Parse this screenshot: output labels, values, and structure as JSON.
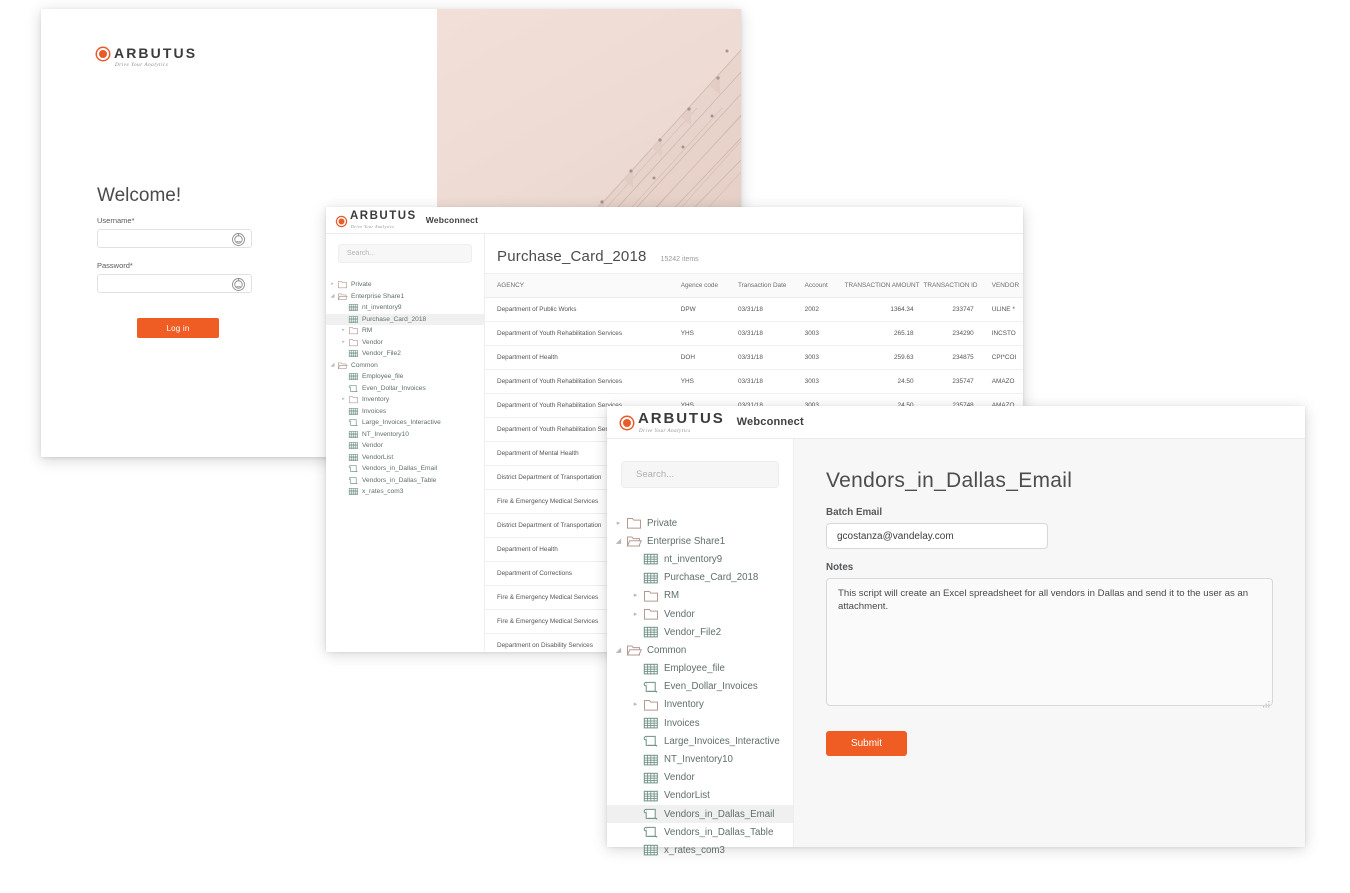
{
  "brand": {
    "name": "ARBUTUS",
    "tagline": "Drive Your Analytics",
    "app": "Webconnect",
    "accent": "#ef5c24"
  },
  "login": {
    "welcome": "Welcome!",
    "username_label": "Username*",
    "username_value": "",
    "password_label": "Password*",
    "password_value": "",
    "login_button": "Log in",
    "field_icon": "circle-key-icon"
  },
  "list_window": {
    "search_placeholder": "Search...",
    "title": "Purchase_Card_2018",
    "item_count": "15242 items",
    "columns": [
      "AGENCY",
      "Agence code",
      "Transaction Date",
      "Account",
      "TRANSACTION AMOUNT",
      "TRANSACTION ID",
      "VENDOR"
    ],
    "rows": [
      [
        "Department of Public Works",
        "DPW",
        "03/31/18",
        "2002",
        "1364.34",
        "233747",
        "ULINE *"
      ],
      [
        "Department of Youth Rehabilitation Services",
        "YHS",
        "03/31/18",
        "3003",
        "265.18",
        "234290",
        "INCSTO"
      ],
      [
        "Department of Health",
        "DOH",
        "03/31/18",
        "3003",
        "259.63",
        "234875",
        "CPI*COI"
      ],
      [
        "Department of Youth Rehabilitation Services",
        "YHS",
        "03/31/18",
        "3003",
        "24.50",
        "235747",
        "AMAZO"
      ],
      [
        "Department of Youth Rehabilitation Services",
        "YHS",
        "03/31/18",
        "3003",
        "24.50",
        "235748",
        "AMAZO"
      ],
      [
        "Department of Youth Rehabilitation Services",
        "",
        "",
        "",
        "",
        "",
        ""
      ],
      [
        "Department of Mental Health",
        "",
        "",
        "",
        "",
        "",
        ""
      ],
      [
        "District Department of Transportation",
        "",
        "",
        "",
        "",
        "",
        ""
      ],
      [
        "Fire & Emergency Medical Services",
        "",
        "",
        "",
        "",
        "",
        ""
      ],
      [
        "District Department of Transportation",
        "",
        "",
        "",
        "",
        "",
        ""
      ],
      [
        "Department of Health",
        "",
        "",
        "",
        "",
        "",
        ""
      ],
      [
        "Department of Corrections",
        "",
        "",
        "",
        "",
        "",
        ""
      ],
      [
        "Fire & Emergency Medical Services",
        "",
        "",
        "",
        "",
        "",
        ""
      ],
      [
        "Fire & Emergency Medical Services",
        "",
        "",
        "",
        "",
        "",
        ""
      ],
      [
        "Department on Disability Services",
        "",
        "",
        "",
        "",
        "",
        ""
      ]
    ],
    "tree": [
      {
        "label": "Private",
        "icon": "folder-closed-icon",
        "level": 1,
        "twist": "collapsed",
        "selected": false
      },
      {
        "label": "Enterprise Share1",
        "icon": "folder-open-icon",
        "level": 1,
        "twist": "expanded",
        "selected": false
      },
      {
        "label": "nt_inventory9",
        "icon": "table-icon",
        "level": 2,
        "twist": "none",
        "selected": false
      },
      {
        "label": "Purchase_Card_2018",
        "icon": "table-icon",
        "level": 2,
        "twist": "none",
        "selected": true
      },
      {
        "label": "RM",
        "icon": "folder-closed-icon",
        "level": 2,
        "twist": "collapsed",
        "selected": false
      },
      {
        "label": "Vendor",
        "icon": "folder-closed-icon",
        "level": 2,
        "twist": "collapsed",
        "selected": false
      },
      {
        "label": "Vendor_File2",
        "icon": "table-icon",
        "level": 2,
        "twist": "none",
        "selected": false
      },
      {
        "label": "Common",
        "icon": "folder-open-icon",
        "level": 1,
        "twist": "expanded",
        "selected": false
      },
      {
        "label": "Employee_file",
        "icon": "table-icon",
        "level": 2,
        "twist": "none",
        "selected": false
      },
      {
        "label": "Even_Dollar_Invoices",
        "icon": "script-icon",
        "level": 2,
        "twist": "none",
        "selected": false
      },
      {
        "label": "Inventory",
        "icon": "folder-closed-icon",
        "level": 2,
        "twist": "collapsed",
        "selected": false
      },
      {
        "label": "Invoices",
        "icon": "table-icon",
        "level": 2,
        "twist": "none",
        "selected": false
      },
      {
        "label": "Large_Invoices_Interactive",
        "icon": "script-icon",
        "level": 2,
        "twist": "none",
        "selected": false
      },
      {
        "label": "NT_Inventory10",
        "icon": "table-icon",
        "level": 2,
        "twist": "none",
        "selected": false
      },
      {
        "label": "Vendor",
        "icon": "table-icon",
        "level": 2,
        "twist": "none",
        "selected": false
      },
      {
        "label": "VendorList",
        "icon": "table-icon",
        "level": 2,
        "twist": "none",
        "selected": false
      },
      {
        "label": "Vendors_in_Dallas_Email",
        "icon": "script-icon",
        "level": 2,
        "twist": "none",
        "selected": false
      },
      {
        "label": "Vendors_in_Dallas_Table",
        "icon": "script-icon",
        "level": 2,
        "twist": "none",
        "selected": false
      },
      {
        "label": "x_rates_com3",
        "icon": "table-icon",
        "level": 2,
        "twist": "none",
        "selected": false
      }
    ]
  },
  "form_window": {
    "search_placeholder": "Search...",
    "title": "Vendors_in_Dallas_Email",
    "batch_email_label": "Batch Email",
    "batch_email_value": "gcostanza@vandelay.com",
    "notes_label": "Notes",
    "notes_value": "This script will create an Excel spreadsheet for all vendors in Dallas and send it to the user as an attachment.",
    "submit_label": "Submit",
    "tree": [
      {
        "label": "Private",
        "icon": "folder-closed-icon",
        "level": 1,
        "twist": "collapsed",
        "selected": false
      },
      {
        "label": "Enterprise Share1",
        "icon": "folder-open-icon",
        "level": 1,
        "twist": "expanded",
        "selected": false
      },
      {
        "label": "nt_inventory9",
        "icon": "table-icon",
        "level": 2,
        "twist": "none",
        "selected": false
      },
      {
        "label": "Purchase_Card_2018",
        "icon": "table-icon",
        "level": 2,
        "twist": "none",
        "selected": false
      },
      {
        "label": "RM",
        "icon": "folder-closed-icon",
        "level": 2,
        "twist": "collapsed",
        "selected": false
      },
      {
        "label": "Vendor",
        "icon": "folder-closed-icon",
        "level": 2,
        "twist": "collapsed",
        "selected": false
      },
      {
        "label": "Vendor_File2",
        "icon": "table-icon",
        "level": 2,
        "twist": "none",
        "selected": false
      },
      {
        "label": "Common",
        "icon": "folder-open-icon",
        "level": 1,
        "twist": "expanded",
        "selected": false
      },
      {
        "label": "Employee_file",
        "icon": "table-icon",
        "level": 2,
        "twist": "none",
        "selected": false
      },
      {
        "label": "Even_Dollar_Invoices",
        "icon": "script-icon",
        "level": 2,
        "twist": "none",
        "selected": false
      },
      {
        "label": "Inventory",
        "icon": "folder-closed-icon",
        "level": 2,
        "twist": "collapsed",
        "selected": false
      },
      {
        "label": "Invoices",
        "icon": "table-icon",
        "level": 2,
        "twist": "none",
        "selected": false
      },
      {
        "label": "Large_Invoices_Interactive",
        "icon": "script-icon",
        "level": 2,
        "twist": "none",
        "selected": false
      },
      {
        "label": "NT_Inventory10",
        "icon": "table-icon",
        "level": 2,
        "twist": "none",
        "selected": false
      },
      {
        "label": "Vendor",
        "icon": "table-icon",
        "level": 2,
        "twist": "none",
        "selected": false
      },
      {
        "label": "VendorList",
        "icon": "table-icon",
        "level": 2,
        "twist": "none",
        "selected": false
      },
      {
        "label": "Vendors_in_Dallas_Email",
        "icon": "script-icon",
        "level": 2,
        "twist": "none",
        "selected": true
      },
      {
        "label": "Vendors_in_Dallas_Table",
        "icon": "script-icon",
        "level": 2,
        "twist": "none",
        "selected": false
      },
      {
        "label": "x_rates_com3",
        "icon": "table-icon",
        "level": 2,
        "twist": "none",
        "selected": false
      }
    ]
  }
}
